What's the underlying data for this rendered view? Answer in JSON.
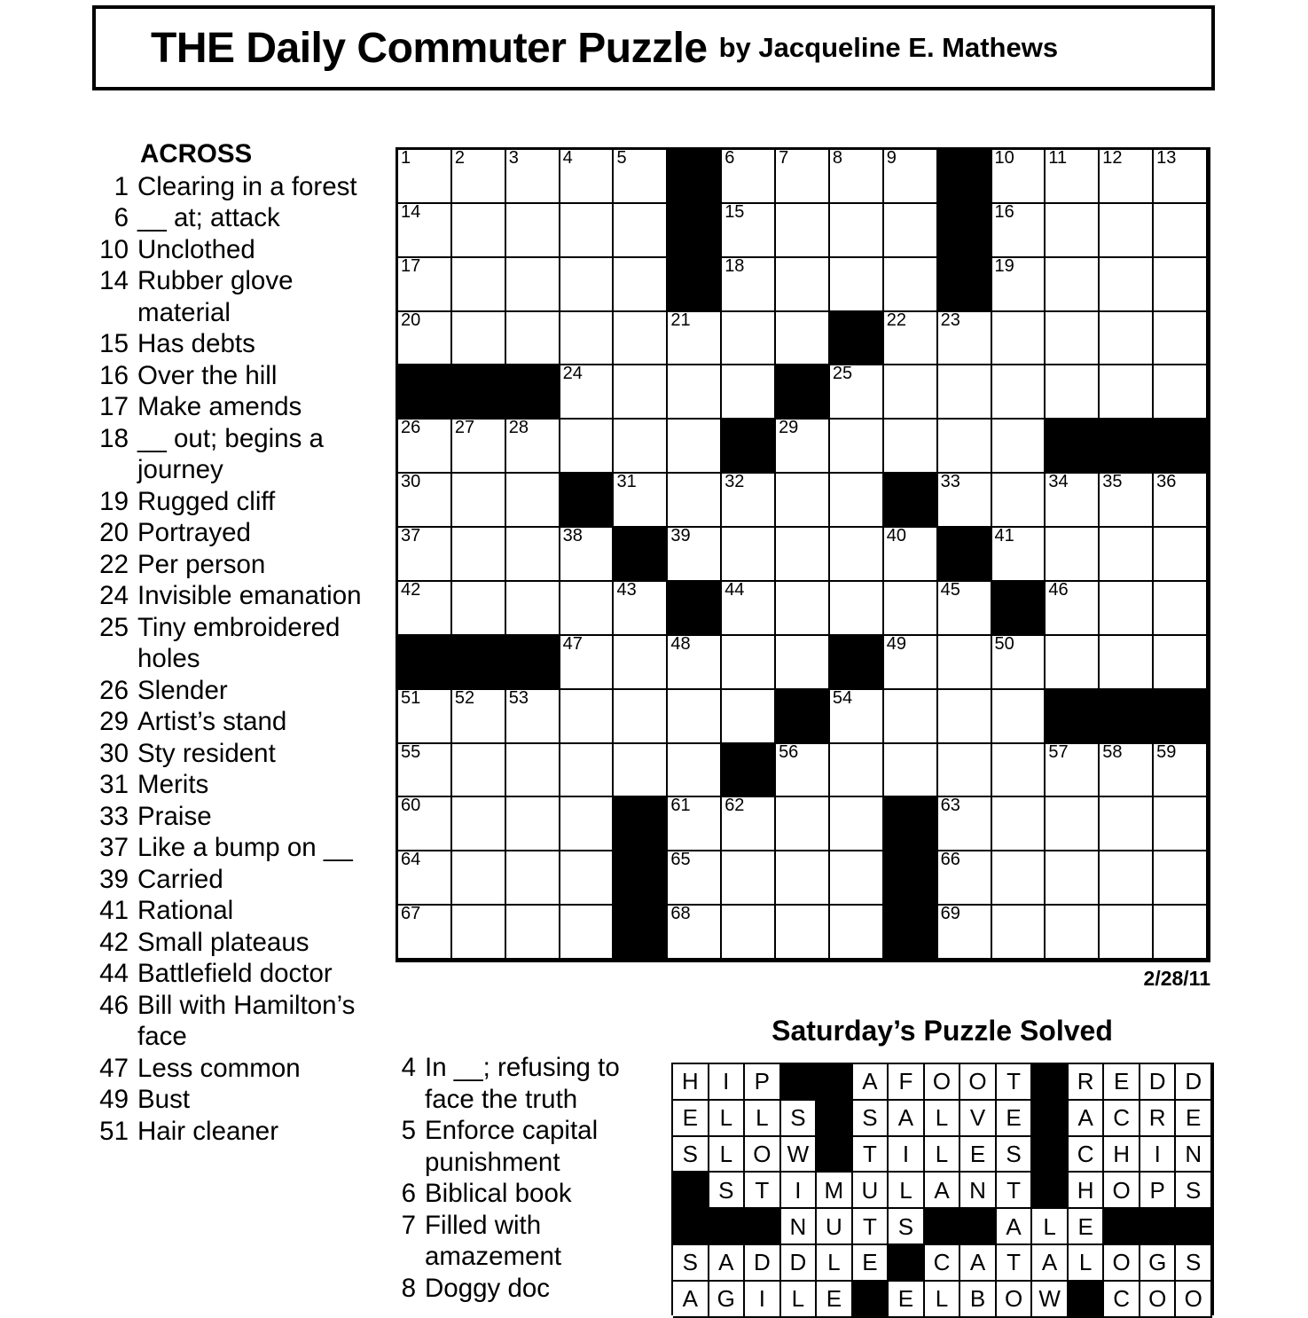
{
  "header": {
    "title": "THE Daily Commuter Puzzle",
    "byline": "by Jacqueline E. Mathews"
  },
  "grid": {
    "date": "2/28/11",
    "rows": 15,
    "cols": 15,
    "blocks": [
      [
        0,
        5
      ],
      [
        0,
        10
      ],
      [
        1,
        5
      ],
      [
        1,
        10
      ],
      [
        2,
        5
      ],
      [
        2,
        10
      ],
      [
        3,
        8
      ],
      [
        4,
        0
      ],
      [
        4,
        1
      ],
      [
        4,
        2
      ],
      [
        4,
        7
      ],
      [
        5,
        6
      ],
      [
        5,
        12
      ],
      [
        5,
        13
      ],
      [
        5,
        14
      ],
      [
        6,
        3
      ],
      [
        6,
        9
      ],
      [
        7,
        4
      ],
      [
        7,
        10
      ],
      [
        8,
        5
      ],
      [
        8,
        11
      ],
      [
        9,
        0
      ],
      [
        9,
        1
      ],
      [
        9,
        2
      ],
      [
        9,
        8
      ],
      [
        10,
        7
      ],
      [
        10,
        12
      ],
      [
        10,
        13
      ],
      [
        10,
        14
      ],
      [
        11,
        6
      ],
      [
        12,
        4
      ],
      [
        12,
        9
      ],
      [
        13,
        4
      ],
      [
        13,
        9
      ],
      [
        14,
        4
      ],
      [
        14,
        9
      ]
    ],
    "numbers": {
      "0,0": "1",
      "0,1": "2",
      "0,2": "3",
      "0,3": "4",
      "0,4": "5",
      "0,6": "6",
      "0,7": "7",
      "0,8": "8",
      "0,9": "9",
      "0,11": "10",
      "0,12": "11",
      "0,13": "12",
      "0,14": "13",
      "1,0": "14",
      "1,6": "15",
      "1,11": "16",
      "2,0": "17",
      "2,6": "18",
      "2,11": "19",
      "3,0": "20",
      "3,5": "21",
      "3,9": "22",
      "3,10": "23",
      "4,3": "24",
      "4,8": "25",
      "5,0": "26",
      "5,1": "27",
      "5,2": "28",
      "5,7": "29",
      "6,0": "30",
      "6,4": "31",
      "6,6": "32",
      "6,10": "33",
      "6,12": "34",
      "6,13": "35",
      "6,14": "36",
      "7,0": "37",
      "7,3": "38",
      "7,5": "39",
      "7,9": "40",
      "7,11": "41",
      "8,0": "42",
      "8,4": "43",
      "8,6": "44",
      "8,10": "45",
      "8,12": "46",
      "9,3": "47",
      "9,5": "48",
      "9,9": "49",
      "9,11": "50",
      "10,0": "51",
      "10,1": "52",
      "10,2": "53",
      "10,8": "54",
      "11,0": "55",
      "11,7": "56",
      "11,12": "57",
      "11,13": "58",
      "11,14": "59",
      "12,0": "60",
      "12,5": "61",
      "12,6": "62",
      "12,10": "63",
      "13,0": "64",
      "13,5": "65",
      "13,10": "66",
      "14,0": "67",
      "14,5": "68",
      "14,10": "69"
    }
  },
  "across": {
    "heading": "ACROSS",
    "clues": [
      {
        "num": "1",
        "text": "Clearing in a forest"
      },
      {
        "num": "6",
        "text": "__ at; attack"
      },
      {
        "num": "10",
        "text": "Unclothed"
      },
      {
        "num": "14",
        "text": "Rubber glove material"
      },
      {
        "num": "15",
        "text": "Has debts"
      },
      {
        "num": "16",
        "text": "Over the hill"
      },
      {
        "num": "17",
        "text": "Make amends"
      },
      {
        "num": "18",
        "text": "__ out; begins a journey"
      },
      {
        "num": "19",
        "text": "Rugged cliff"
      },
      {
        "num": "20",
        "text": "Portrayed"
      },
      {
        "num": "22",
        "text": "Per person"
      },
      {
        "num": "24",
        "text": "Invisible emanation"
      },
      {
        "num": "25",
        "text": "Tiny embroidered holes"
      },
      {
        "num": "26",
        "text": "Slender"
      },
      {
        "num": "29",
        "text": "Artist’s stand"
      },
      {
        "num": "30",
        "text": "Sty resident"
      },
      {
        "num": "31",
        "text": "Merits"
      },
      {
        "num": "33",
        "text": "Praise"
      },
      {
        "num": "37",
        "text": "Like a bump on __"
      },
      {
        "num": "39",
        "text": "Carried"
      },
      {
        "num": "41",
        "text": "Rational"
      },
      {
        "num": "42",
        "text": "Small plateaus"
      },
      {
        "num": "44",
        "text": "Battlefield doctor"
      },
      {
        "num": "46",
        "text": "Bill with Hamilton’s face"
      },
      {
        "num": "47",
        "text": "Less common"
      },
      {
        "num": "49",
        "text": "Bust"
      },
      {
        "num": "51",
        "text": "Hair cleaner"
      }
    ]
  },
  "down": {
    "clues": [
      {
        "num": "4",
        "text": "In __; refusing to face the truth"
      },
      {
        "num": "5",
        "text": "Enforce capital punishment"
      },
      {
        "num": "6",
        "text": "Biblical book"
      },
      {
        "num": "7",
        "text": "Filled with amazement"
      },
      {
        "num": "8",
        "text": "Doggy doc"
      }
    ]
  },
  "solution": {
    "title": "Saturday’s Puzzle Solved",
    "rows": [
      [
        "H",
        "I",
        "P",
        "",
        "",
        "A",
        "F",
        "O",
        "O",
        "T",
        "",
        "R",
        "E",
        "D",
        "D"
      ],
      [
        "E",
        "L",
        "L",
        "S",
        "",
        "S",
        "A",
        "L",
        "V",
        "E",
        "",
        "A",
        "C",
        "R",
        "E"
      ],
      [
        "S",
        "L",
        "O",
        "W",
        "",
        "T",
        "I",
        "L",
        "E",
        "S",
        "",
        "C",
        "H",
        "I",
        "N"
      ],
      [
        "",
        "S",
        "T",
        "I",
        "M",
        "U",
        "L",
        "A",
        "N",
        "T",
        "",
        "H",
        "O",
        "P",
        "S"
      ],
      [
        "",
        "",
        "",
        "N",
        "U",
        "T",
        "S",
        "",
        "",
        "A",
        "L",
        "E",
        "",
        "",
        ""
      ],
      [
        "S",
        "A",
        "D",
        "D",
        "L",
        "E",
        "",
        "C",
        "A",
        "T",
        "A",
        "L",
        "O",
        "G",
        "S"
      ],
      [
        "A",
        "G",
        "I",
        "L",
        "E",
        "",
        "E",
        "L",
        "B",
        "O",
        "W",
        "",
        "C",
        "O",
        "O"
      ]
    ]
  }
}
